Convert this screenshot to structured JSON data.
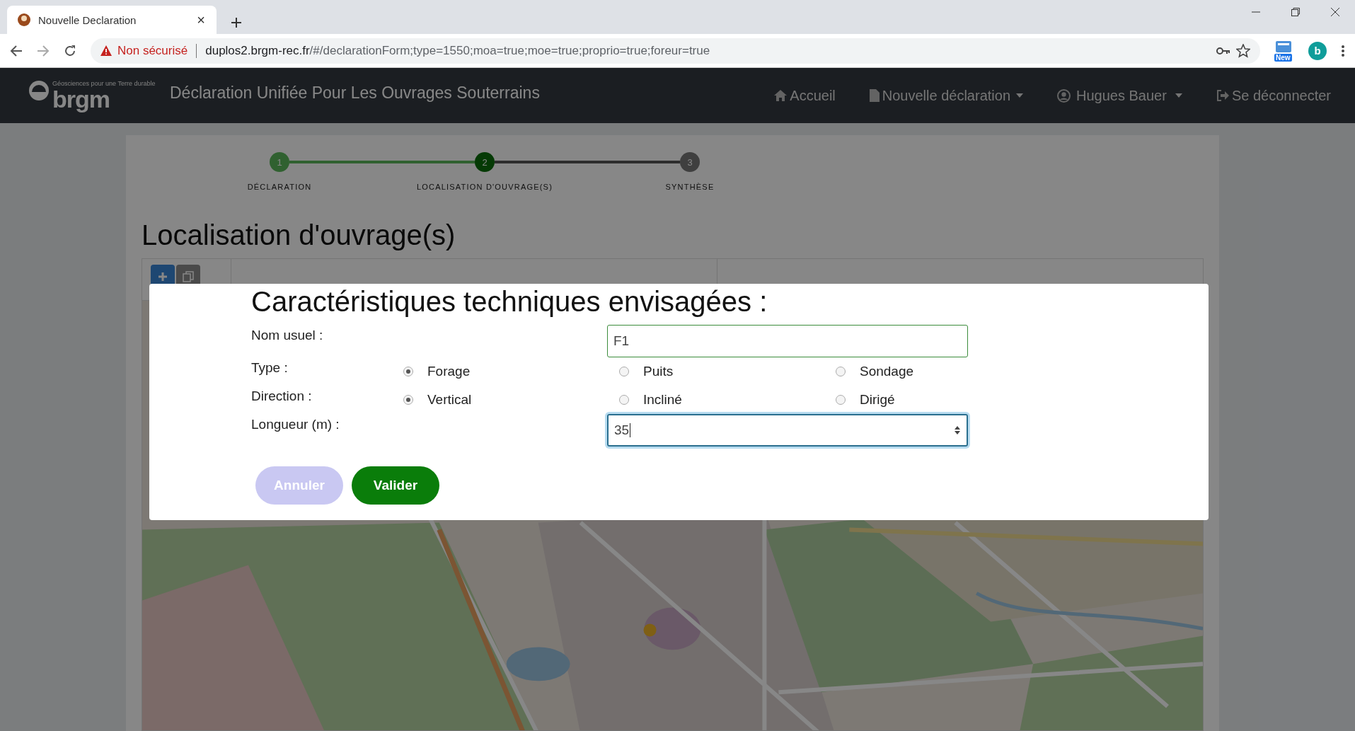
{
  "browser": {
    "tab_title": "Nouvelle Declaration",
    "tab_close": "×",
    "security": "Non sécurisé",
    "url_host": "duplos2.brgm-rec.fr",
    "url_path": "/#/declarationForm;type=1550;moa=true;moe=true;proprio=true;foreur=true",
    "extension_badge": "New",
    "profile": "b"
  },
  "navbar": {
    "logo_tagline": "Géosciences pour une Terre durable",
    "logo_text": "brgm",
    "title": "Déclaration Unifiée Pour Les Ouvrages Souterrains",
    "links": [
      {
        "label": "Accueil",
        "kind": "home",
        "dropdown": false
      },
      {
        "label": "Nouvelle déclaration",
        "kind": "file",
        "dropdown": true
      },
      {
        "label": "Hugues Bauer",
        "kind": "user",
        "dropdown": true
      },
      {
        "label": "Se déconnecter",
        "kind": "logout",
        "dropdown": false
      }
    ]
  },
  "stepper": [
    {
      "number": "1",
      "label": "DÉCLARATION",
      "completed": true,
      "selected": false
    },
    {
      "number": "2",
      "label": "LOCALISATION D'OUVRAGE(S)",
      "completed": false,
      "selected": true
    },
    {
      "number": "3",
      "label": "SYNTHÈSE",
      "completed": false,
      "selected": false
    }
  ],
  "page_title": "Localisation d'ouvrage(s)",
  "modal": {
    "title": "Caractéristiques techniques envisagées :",
    "name": {
      "label": "Nom usuel :",
      "value": "F1"
    },
    "type": {
      "label": "Type :",
      "options": [
        {
          "label": "Forage",
          "selected": true
        },
        {
          "label": "Puits",
          "selected": false
        },
        {
          "label": "Sondage",
          "selected": false
        }
      ]
    },
    "direction": {
      "label": "Direction :",
      "options": [
        {
          "label": "Vertical",
          "selected": true
        },
        {
          "label": "Incliné",
          "selected": false
        },
        {
          "label": "Dirigé",
          "selected": false
        }
      ]
    },
    "length": {
      "label": "Longueur (m) :",
      "value": "35",
      "focused": true
    },
    "buttons": [
      {
        "label": "Annuler",
        "kind": "cancel"
      },
      {
        "label": "Valider",
        "kind": "primary"
      }
    ]
  }
}
